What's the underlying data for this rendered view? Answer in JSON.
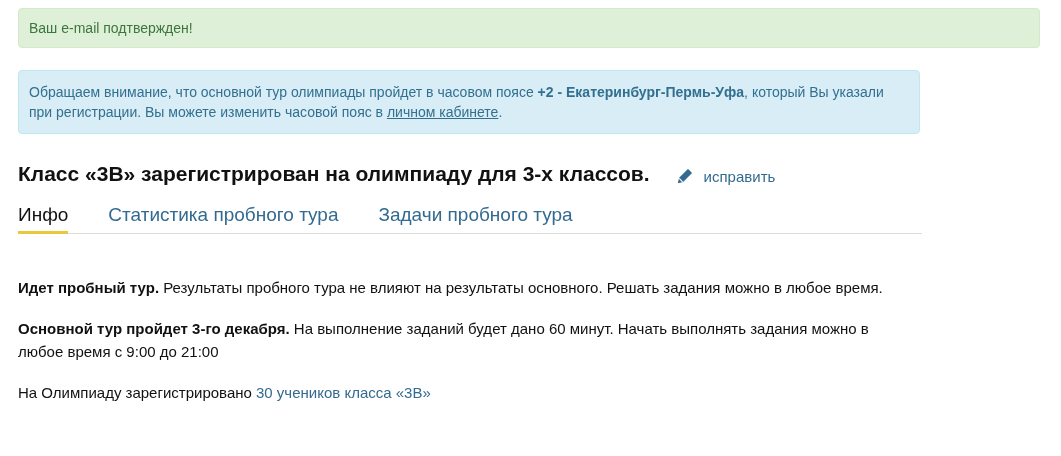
{
  "alerts": [
    {
      "kind": "success",
      "text": "Ваш e-mail подтвержден!"
    },
    {
      "kind": "info",
      "text": "Обращаем внимание, что основной тур олимпиады пройдет в часовом поясе **+2 - Екатеринбург-Пермь-Уфа**, который Вы указали при регистрации. Вы можете изменить часовой пояс в ",
      "link": "личном кабинете",
      "text_after": "."
    }
  ],
  "heading": {
    "title": "Класс «3В» зарегистрирован на олимпиаду для 3-х классов.",
    "edit_link": "исправить"
  },
  "tabs": [
    {
      "label": "Инфо",
      "selected": true
    },
    {
      "label": "Статистика пробного тура",
      "selected": false
    },
    {
      "label": "Задачи пробного тура",
      "selected": false
    }
  ],
  "paragraphs": [
    {
      "text": "**Идет пробный тур.** Результаты пробного тура не влияют на результаты основного. Решать задания можно в любое время."
    },
    {
      "text": "**Основной тур пройдет 3-го декабря.** На выполнение заданий будет дано 60 минут. Начать выполнять задания можно в любое время с 9:00 до 21:00"
    },
    {
      "text": "На Олимпиаду зарегистрировано ",
      "link": "30 учеников класса «3В»"
    }
  ]
}
